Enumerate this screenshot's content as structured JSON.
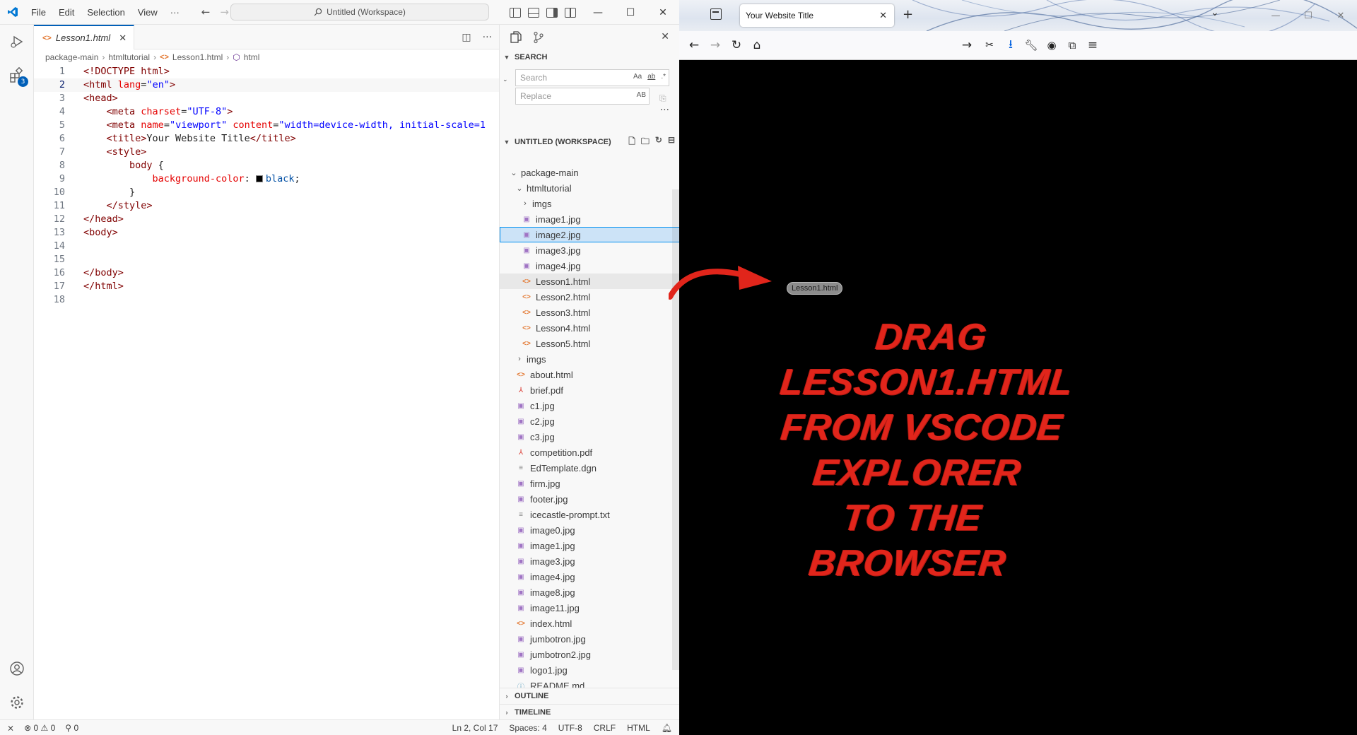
{
  "vscode": {
    "menu": [
      "File",
      "Edit",
      "Selection",
      "View",
      "···"
    ],
    "command_center": "Untitled (Workspace)",
    "activity_badge": "3",
    "tab": {
      "label": "Lesson1.html"
    },
    "breadcrumb": [
      "package-main",
      "htmltutorial",
      "Lesson1.html",
      "html"
    ],
    "code_lines": [
      {
        "num": "1",
        "html": "<span class='t-doc'>&lt;!DOCTYPE html&gt;</span>"
      },
      {
        "num": "2",
        "html": "<span class='t-tag'>&lt;html</span> <span class='t-attr'>lang</span>=<span class='t-val'>\"en\"</span><span class='t-tag'>&gt;</span>"
      },
      {
        "num": "3",
        "html": "<span class='t-tag'>&lt;head&gt;</span>"
      },
      {
        "num": "4",
        "html": "    <span class='t-tag'>&lt;meta</span> <span class='t-attr'>charset</span>=<span class='t-val'>\"UTF-8\"</span><span class='t-tag'>&gt;</span>"
      },
      {
        "num": "5",
        "html": "    <span class='t-tag'>&lt;meta</span> <span class='t-attr'>name</span>=<span class='t-val'>\"viewport\"</span> <span class='t-attr'>content</span>=<span class='t-val'>\"width=device-width, initial-scale=1</span>"
      },
      {
        "num": "6",
        "html": "    <span class='t-tag'>&lt;title&gt;</span>Your Website Title<span class='t-tag'>&lt;/title&gt;</span>"
      },
      {
        "num": "7",
        "html": "    <span class='t-tag'>&lt;style&gt;</span>"
      },
      {
        "num": "8",
        "html": "        <span class='t-sel'>body</span> {"
      },
      {
        "num": "9",
        "html": "            <span class='t-prop'>background-color</span>: <span class='swatch'></span><span class='t-kw'>black</span>;"
      },
      {
        "num": "10",
        "html": "        }"
      },
      {
        "num": "11",
        "html": "    <span class='t-tag'>&lt;/style&gt;</span>"
      },
      {
        "num": "12",
        "html": "<span class='t-tag'>&lt;/head&gt;</span>"
      },
      {
        "num": "13",
        "html": "<span class='t-tag'>&lt;body&gt;</span>"
      },
      {
        "num": "14",
        "html": ""
      },
      {
        "num": "15",
        "html": ""
      },
      {
        "num": "16",
        "html": "<span class='t-tag'>&lt;/body&gt;</span>"
      },
      {
        "num": "17",
        "html": "<span class='t-tag'>&lt;/html&gt;</span>"
      },
      {
        "num": "18",
        "html": ""
      }
    ],
    "active_line": "2",
    "search": {
      "title": "SEARCH",
      "search_placeholder": "Search",
      "replace_placeholder": "Replace",
      "opt_case": "Aa",
      "opt_word": "ab",
      "opt_regex": ".*",
      "opt_preserve": "AB"
    },
    "workspace_title": "UNTITLED (WORKSPACE)",
    "tree": [
      {
        "label": "package-main",
        "depth": 0,
        "type": "folder-open"
      },
      {
        "label": "htmltutorial",
        "depth": 1,
        "type": "folder-open"
      },
      {
        "label": "imgs",
        "depth": 2,
        "type": "folder"
      },
      {
        "label": "image1.jpg",
        "depth": 2,
        "type": "img"
      },
      {
        "label": "image2.jpg",
        "depth": 2,
        "type": "img",
        "state": "sel"
      },
      {
        "label": "image3.jpg",
        "depth": 2,
        "type": "img"
      },
      {
        "label": "image4.jpg",
        "depth": 2,
        "type": "img"
      },
      {
        "label": "Lesson1.html",
        "depth": 2,
        "type": "html",
        "state": "hov"
      },
      {
        "label": "Lesson2.html",
        "depth": 2,
        "type": "html"
      },
      {
        "label": "Lesson3.html",
        "depth": 2,
        "type": "html"
      },
      {
        "label": "Lesson4.html",
        "depth": 2,
        "type": "html"
      },
      {
        "label": "Lesson5.html",
        "depth": 2,
        "type": "html"
      },
      {
        "label": "imgs",
        "depth": 1,
        "type": "folder"
      },
      {
        "label": "about.html",
        "depth": 1,
        "type": "html"
      },
      {
        "label": "brief.pdf",
        "depth": 1,
        "type": "pdf"
      },
      {
        "label": "c1.jpg",
        "depth": 1,
        "type": "img"
      },
      {
        "label": "c2.jpg",
        "depth": 1,
        "type": "img"
      },
      {
        "label": "c3.jpg",
        "depth": 1,
        "type": "img"
      },
      {
        "label": "competition.pdf",
        "depth": 1,
        "type": "pdf"
      },
      {
        "label": "EdTemplate.dgn",
        "depth": 1,
        "type": "txt"
      },
      {
        "label": "firm.jpg",
        "depth": 1,
        "type": "img"
      },
      {
        "label": "footer.jpg",
        "depth": 1,
        "type": "img"
      },
      {
        "label": "icecastle-prompt.txt",
        "depth": 1,
        "type": "txt"
      },
      {
        "label": "image0.jpg",
        "depth": 1,
        "type": "img"
      },
      {
        "label": "image1.jpg",
        "depth": 1,
        "type": "img"
      },
      {
        "label": "image3.jpg",
        "depth": 1,
        "type": "img"
      },
      {
        "label": "image4.jpg",
        "depth": 1,
        "type": "img"
      },
      {
        "label": "image8.jpg",
        "depth": 1,
        "type": "img"
      },
      {
        "label": "image11.jpg",
        "depth": 1,
        "type": "img"
      },
      {
        "label": "index.html",
        "depth": 1,
        "type": "html"
      },
      {
        "label": "jumbotron.jpg",
        "depth": 1,
        "type": "img"
      },
      {
        "label": "jumbotron2.jpg",
        "depth": 1,
        "type": "img"
      },
      {
        "label": "logo1.jpg",
        "depth": 1,
        "type": "img"
      },
      {
        "label": "README.md",
        "depth": 1,
        "type": "md"
      }
    ],
    "outline_title": "OUTLINE",
    "timeline_title": "TIMELINE",
    "status": {
      "errors": "0",
      "warnings": "0",
      "ports": "0",
      "position": "Ln 2, Col 17",
      "spaces": "Spaces: 4",
      "encoding": "UTF-8",
      "eol": "CRLF",
      "language": "HTML"
    }
  },
  "browser": {
    "tab_title": "Your Website Title",
    "drag_chip": "Lesson1.html",
    "message_lines": [
      "DRAG",
      "LESSON1.HTML",
      "FROM VSCODE",
      "EXPLORER",
      "TO THE",
      "BROWSER"
    ],
    "arrow_color": "#e1251b",
    "background": "#000000"
  }
}
